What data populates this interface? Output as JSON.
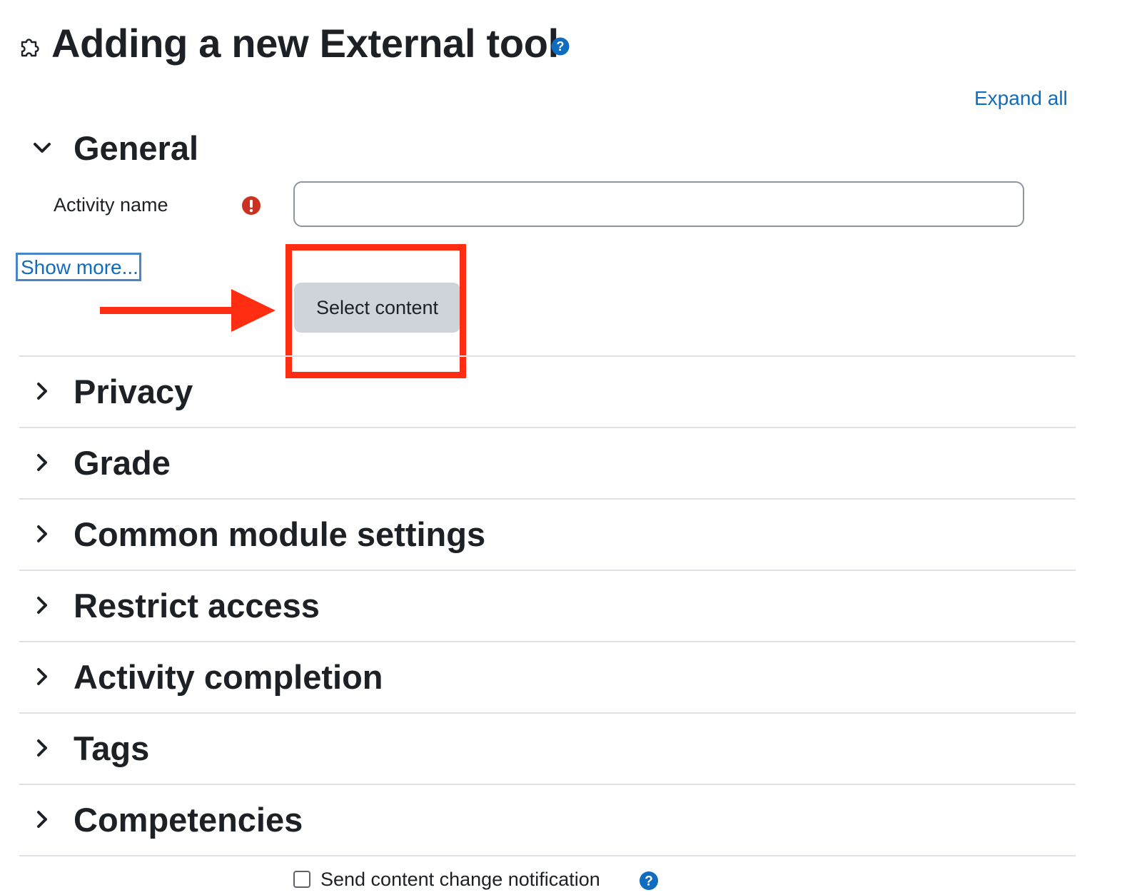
{
  "page": {
    "title": "Adding a new External tool",
    "expand_all_label": "Expand all"
  },
  "icons": {
    "module_icon": "puzzle-piece-icon",
    "help_icon": "question-circle-icon",
    "required_icon": "exclamation-circle-icon",
    "expanded_icon": "chevron-down-icon",
    "collapsed_icon": "chevron-right-icon"
  },
  "colors": {
    "link": "#0f6cbf",
    "required": "#ca3120",
    "help": "#0f6cbf",
    "button_bg": "#ced4da",
    "annotation": "#ff2d12"
  },
  "general": {
    "title": "General",
    "expanded": true,
    "activity_name_label": "Activity name",
    "activity_name_value": "",
    "show_more_label": "Show more...",
    "select_content_label": "Select content"
  },
  "sections": [
    {
      "title": "Privacy",
      "expanded": false
    },
    {
      "title": "Grade",
      "expanded": false
    },
    {
      "title": "Common module settings",
      "expanded": false
    },
    {
      "title": "Restrict access",
      "expanded": false
    },
    {
      "title": "Activity completion",
      "expanded": false
    },
    {
      "title": "Tags",
      "expanded": false
    },
    {
      "title": "Competencies",
      "expanded": false
    }
  ],
  "notification": {
    "label": "Send content change notification",
    "checked": false
  }
}
